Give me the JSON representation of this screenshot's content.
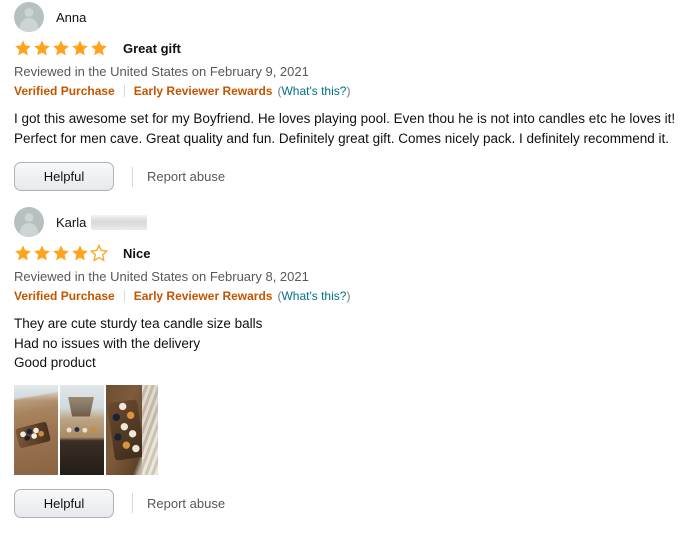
{
  "reviews": [
    {
      "avatar_icon": "user-avatar-icon",
      "reviewer_name": "Anna",
      "name_redacted": false,
      "rating": 5,
      "rating_max": 5,
      "title": "Great gift",
      "date_line": "Reviewed in the United States on February 9, 2021",
      "verified_purchase_label": "Verified Purchase",
      "early_reviewer_label": "Early Reviewer Rewards",
      "whats_this_open": "(",
      "whats_this_label": "What's this?",
      "whats_this_close": ")",
      "body_lines": [
        "I got this awesome set for my Boyfriend. He loves playing pool. Even thou he is not into candles etc he loves it! Perfect for men cave. Great quality and fun. Definitely great gift. Comes nicely pack. I definitely recommend it."
      ],
      "images": [],
      "helpful_label": "Helpful",
      "report_abuse_label": "Report abuse"
    },
    {
      "avatar_icon": "user-avatar-icon",
      "reviewer_name": "Karla",
      "name_redacted": true,
      "rating": 4,
      "rating_max": 5,
      "title": "Nice",
      "date_line": "Reviewed in the United States on February 8, 2021",
      "verified_purchase_label": "Verified Purchase",
      "early_reviewer_label": "Early Reviewer Rewards",
      "whats_this_open": "(",
      "whats_this_label": "What's this?",
      "whats_this_close": ")",
      "body_lines": [
        "They are cute sturdy tea candle size balls",
        "Had no issues with the delivery",
        "Good product"
      ],
      "images": [
        "customer-photo-candle-tray-on-wood-floor",
        "customer-photo-table-by-window",
        "customer-photo-diamond-rack-of-candles"
      ],
      "helpful_label": "Helpful",
      "report_abuse_label": "Report abuse"
    }
  ],
  "colors": {
    "star_filled": "#FFA41C",
    "star_empty_stroke": "#FFA41C",
    "badge_orange": "#C45500",
    "link_teal": "#007185",
    "text_primary": "#0F1111",
    "text_secondary": "#565959",
    "avatar_bg": "#B6C0C0"
  }
}
